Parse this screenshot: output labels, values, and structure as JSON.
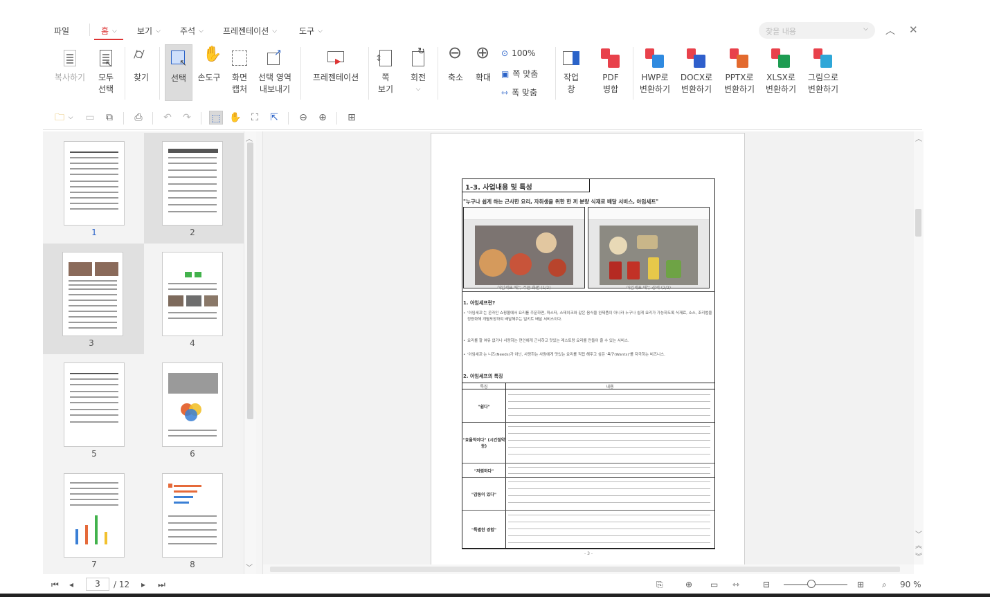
{
  "menu": {
    "file": "파일",
    "home": "홈",
    "view": "보기",
    "annotate": "주석",
    "present": "프레젠테이션",
    "tools": "도구",
    "search_placeholder": "찾을 내용"
  },
  "ribbon": {
    "copy": "복사하기",
    "select_all": [
      "모두",
      "선택"
    ],
    "find": "찾기",
    "select": "선택",
    "hand": "손도구",
    "capture": [
      "화면",
      "캡처"
    ],
    "export_sel": [
      "선택 영역",
      "내보내기"
    ],
    "presentation": "프레젠테이션",
    "page_view": [
      "쪽",
      "보기"
    ],
    "rotate": "회전",
    "zoom_out": "축소",
    "zoom_in": "확대",
    "zoom_100": "100%",
    "fit_page": "쪽 맞춤",
    "fit_width": "폭 맞춤",
    "task_pane": [
      "작업",
      "창"
    ],
    "pdf_merge": [
      "PDF",
      "병합"
    ],
    "to_hwp": [
      "HWP로",
      "변환하기"
    ],
    "to_docx": [
      "DOCX로",
      "변환하기"
    ],
    "to_pptx": [
      "PPTX로",
      "변환하기"
    ],
    "to_xlsx": [
      "XLSX로",
      "변환하기"
    ],
    "to_image": [
      "그림으로",
      "변환하기"
    ]
  },
  "thumbnails": [
    "1",
    "2",
    "3",
    "4",
    "5",
    "6",
    "7",
    "8"
  ],
  "document": {
    "heading": "1-3. 사업내용 및 특성",
    "quote": "\"누구나 쉽게 하는 근사한 요리, 자취생을 위한 한 끼 분량 식재료 배달 서비스, 아임세프\"",
    "caption1": "아임세프 메뉴 주문 화면 (1/2)",
    "caption2": "아임세프 메뉴 상세 (2/2)",
    "sec1": "1. 아임세프란?",
    "sec1_b1": "'아임세프'는 온라인 쇼핑몰에서 요리를 주문하면, 파스타, 스테이크와 같은 음식을 완제품이 아니라 누구나 쉽게 요리가 가능하도록 식재료, 소스, 조리법을 정량화해 개별포장하여 배달해주는 밀키트 배달 서비스이다.",
    "sec1_b2": "요리를 할 여유 없거나 사랑하는 연인에게 근사하고 맛있는 레스토랑 요리를 만들어 줄 수 있는 서비스.",
    "sec1_b3": "'아임세프'는 니즈(Needs)가 아닌, 사랑하는 사람에게 맛있는 요리를 직접 해주고 싶은 '욕구(Wants)'를 자극하는 비즈니스.",
    "sec2": "2. 아임세프의 특징",
    "col_head1": "특징",
    "col_head2": "내용",
    "feature_rows": [
      "\"쉽다\"",
      "\"효율적이다\" (시간절약 등)",
      "\"저렴하다\"",
      "\"감동이 있다\"",
      "\"특별한 경험\""
    ],
    "page_footer": "- 3 -"
  },
  "status": {
    "current_page": "3",
    "total_pages": "/ 12",
    "zoom": "90 %"
  }
}
